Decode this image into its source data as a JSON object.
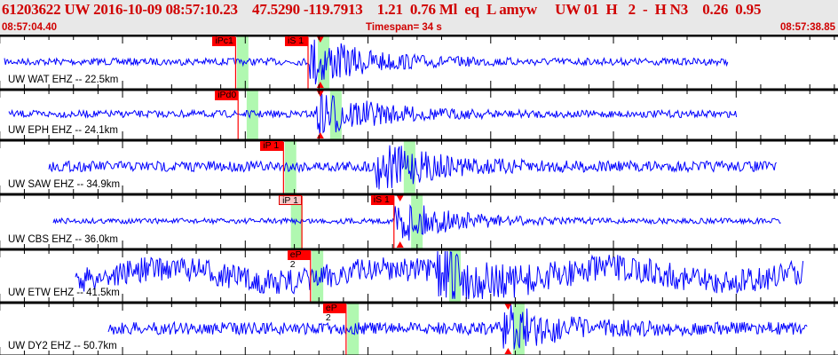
{
  "header": {
    "title": "61203622 UW 2016-10-09 08:57:10.23    47.5290 -119.7913    1.21  0.76 Ml  eq  L amyw     UW 01  H   2  -  H N3    0.26  0.95",
    "start_time": "08:57:04.40",
    "timespan": "Timespan=  34 s",
    "end_time": "08:57:38.85"
  },
  "colors": {
    "trace": "#0000ff",
    "pick": "#ff0000",
    "window": "#b0f8b0",
    "header_text": "#d00000"
  },
  "channels": [
    {
      "label": "UW WAT EHZ -- 22.5km",
      "picks": [
        {
          "label": "iPc1",
          "t": 9.6
        },
        {
          "label": "iS 1",
          "t": 12.55
        }
      ],
      "arrival_marker_t": 13.05,
      "windows": [
        9.65,
        12.95
      ]
    },
    {
      "label": "UW EPH EHZ -- 24.1km",
      "picks": [
        {
          "label": "iPd0",
          "t": 9.7
        }
      ],
      "arrival_marker_t": 13.05,
      "windows": [
        10.05,
        13.45
      ]
    },
    {
      "label": "UW SAW EHZ -- 34.9km",
      "picks": [
        {
          "label": "iP 1",
          "t": 11.55
        }
      ],
      "windows": [
        11.6,
        16.45
      ]
    },
    {
      "label": "UW CBS EHZ -- 36.0km",
      "picks": [
        {
          "label": "iP 1",
          "t": 12.3,
          "light": true
        },
        {
          "label": "iS 1",
          "t": 16.05
        }
      ],
      "arrival_marker_t": 16.3,
      "windows": [
        11.85,
        16.75
      ]
    },
    {
      "label": "UW ETW EHZ -- 41.5km",
      "picks": [
        {
          "label": "eP 2",
          "t": 12.65
        }
      ],
      "windows": [
        12.7,
        18.3
      ]
    },
    {
      "label": "UW DY2 EHZ -- 50.7km",
      "picks": [
        {
          "label": "eP 2",
          "t": 14.1
        }
      ],
      "arrival_marker_t": 20.7,
      "windows": [
        14.15,
        20.9
      ]
    }
  ]
}
